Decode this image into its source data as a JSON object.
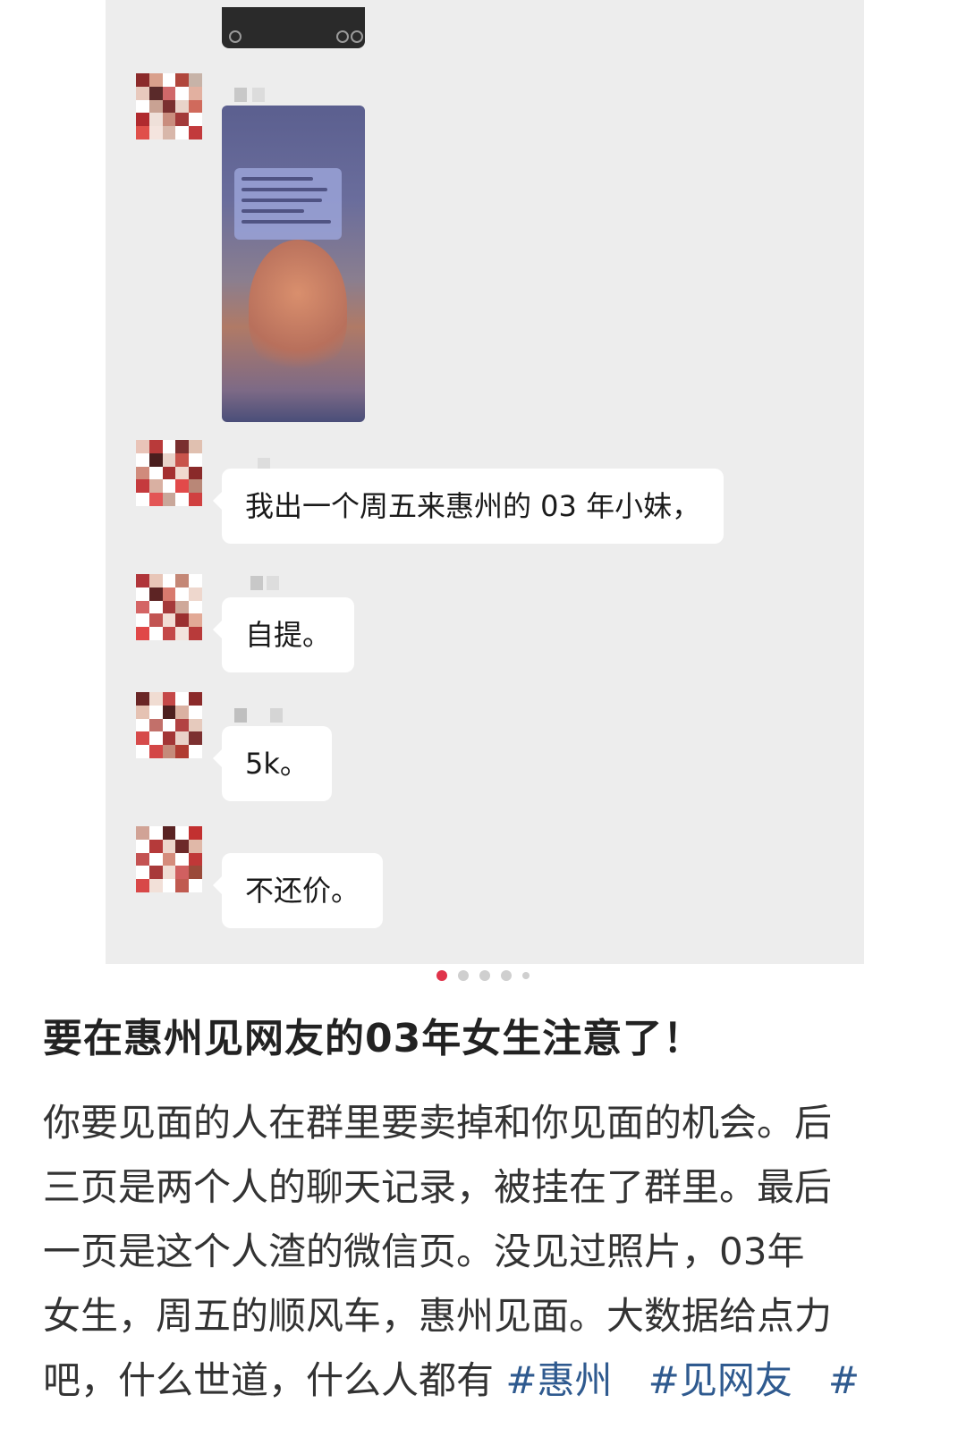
{
  "colors": {
    "chat_bg": "#ededed",
    "bubble_bg": "#ffffff",
    "dot_active": "#e0334a",
    "dot_inactive": "#cfcfcf",
    "title_text": "#222222",
    "body_text": "#333333",
    "hashtag": "#2f5a8f"
  },
  "chat": {
    "messages": [
      {
        "type": "image",
        "description_icon": "phone-screenshot-image"
      },
      {
        "type": "text",
        "text": "我出一个周五来惠州的 03 年小妹，"
      },
      {
        "type": "text",
        "text": "自提。"
      },
      {
        "type": "text",
        "text": "5k。"
      },
      {
        "type": "text",
        "text": "不还价。"
      }
    ]
  },
  "carousel": {
    "count": 5,
    "active_index": 0
  },
  "post": {
    "title": "要在惠州见网友的03年女生注意了！",
    "body_lines": [
      "你要见面的人在群里要卖掉和你见面的机会。后",
      "三页是两个人的聊天记录，被挂在了群里。最后",
      "一页是这个人渣的微信页。没见过照片，03年",
      "女生，周五的顺风车，惠州见面。大数据给点力"
    ],
    "last_line_text": "吧，什么世道，什么人都有 ",
    "hashtags": [
      "#惠州",
      "#见网友",
      "#"
    ]
  }
}
